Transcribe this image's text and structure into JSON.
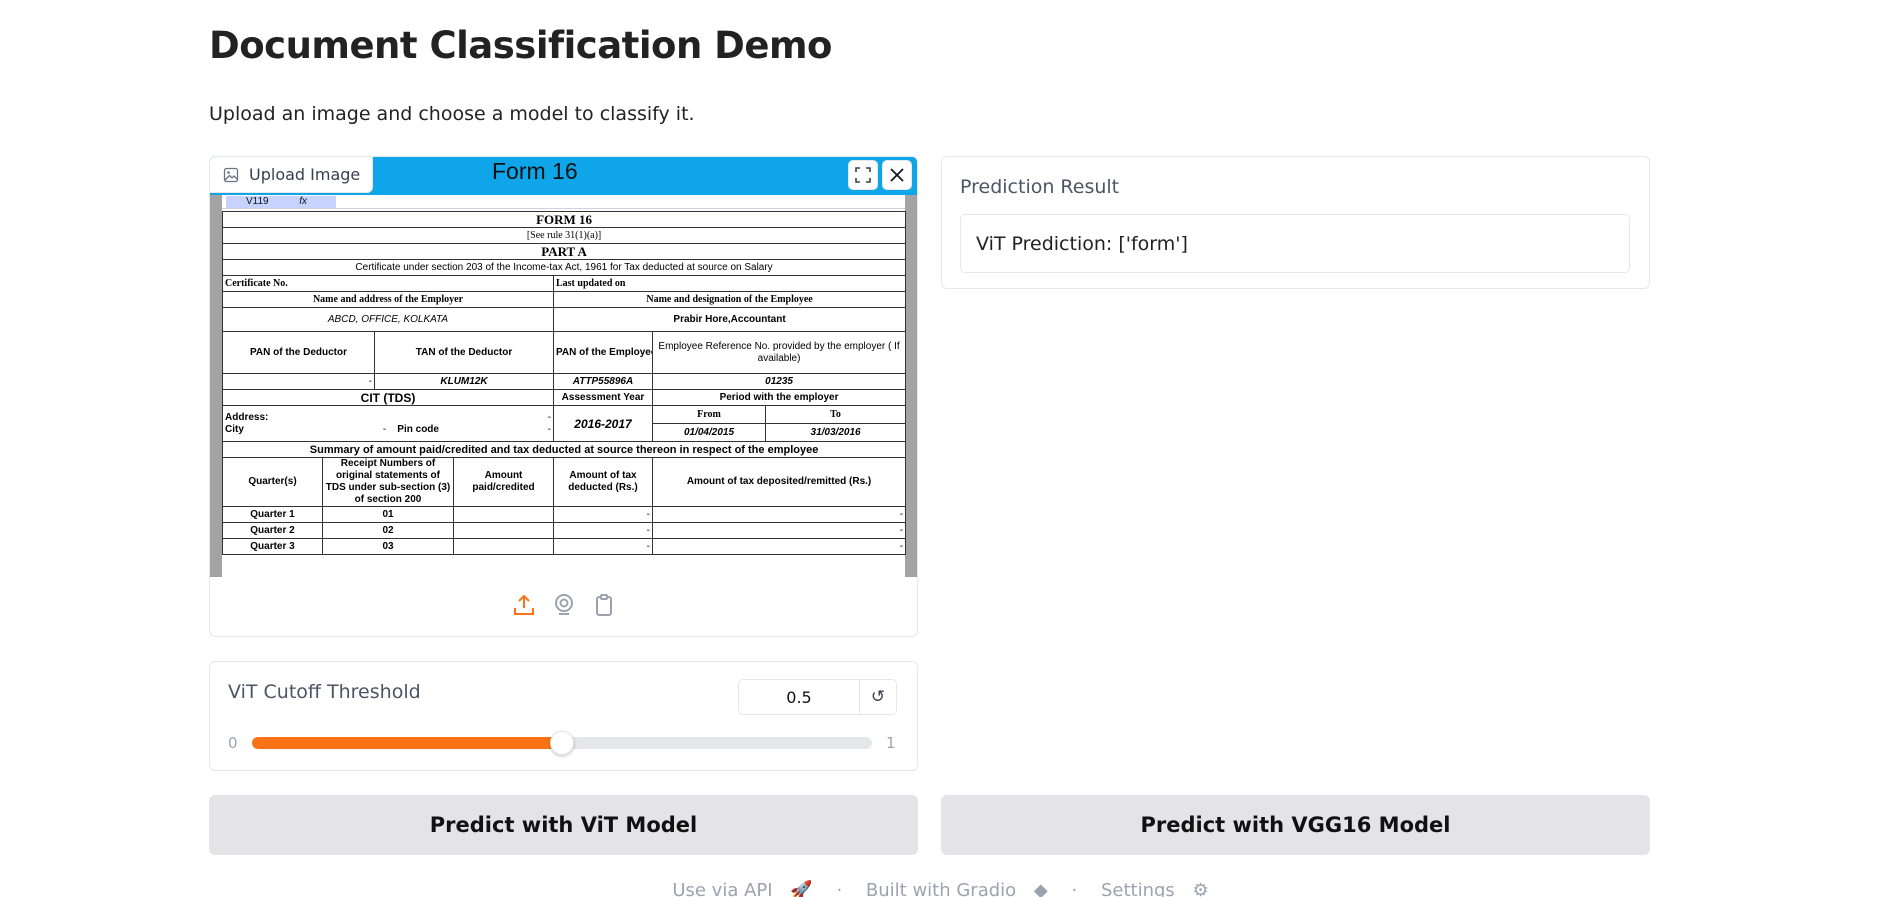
{
  "page": {
    "title": "Document Classification Demo",
    "description": "Upload an image and choose a model to classify it."
  },
  "image_input": {
    "label": "Upload Image",
    "icons": {
      "fullscreen": "fullscreen-icon",
      "clear": "close-icon",
      "upload": "upload-icon",
      "webcam": "webcam-icon",
      "clipboard": "clipboard-icon"
    },
    "document": {
      "banner": "Form 16",
      "cell_ref": "V119",
      "fx": "fx",
      "form_title": "FORM 16",
      "rule": "[See rule 31(1)(a)]",
      "part": "PART A",
      "certificate_line": "Certificate under section 203 of the Income-tax Act, 1961 for Tax deducted at source on Salary",
      "certificate_no": "Certificate No.",
      "last_updated": "Last updated on",
      "employer_name_hdr": "Name and address of the Employer",
      "employee_name_hdr": "Name and designation of the Employee",
      "employer_name": "ABCD, OFFICE, KOLKATA",
      "employee_name": "Prabir Hore,Accountant",
      "pan_deductor_hdr": "PAN of the Deductor",
      "tan_deductor_hdr": "TAN of the Deductor",
      "pan_employee_hdr": "PAN of the Employee",
      "emp_ref_hdr": "Employee Reference No. provided by the employer ( If available)",
      "pan_deductor": "-",
      "tan_deductor": "KLUM12K",
      "pan_employee": "ATTP55896A",
      "emp_ref": "01235",
      "cit_hdr": "CIT (TDS)",
      "assessment_hdr": "Assessment Year",
      "period_hdr": "Period with the employer",
      "address": "Address:",
      "city": "City",
      "pincode": "Pin code",
      "dash": "-",
      "assessment_year": "2016-2017",
      "from_hdr": "From",
      "to_hdr": "To",
      "from": "01/04/2015",
      "to": "31/03/2016",
      "summary": "Summary of amount paid/credited and tax deducted at source thereon in respect of the employee",
      "col_quarters": "Quarter(s)",
      "col_receipt": "Receipt Numbers of original statements of TDS under sub-section (3) of section 200",
      "col_amount": "Amount paid/credited",
      "col_tax_deducted": "Amount of tax deducted (Rs.)",
      "col_tax_deposited": "Amount of tax deposited/remitted (Rs.)",
      "rows": [
        {
          "quarter": "Quarter 1",
          "receipt": "01",
          "amount": "",
          "deducted": "-",
          "deposited": "-"
        },
        {
          "quarter": "Quarter 2",
          "receipt": "02",
          "amount": "",
          "deducted": "-",
          "deposited": "-"
        },
        {
          "quarter": "Quarter 3",
          "receipt": "03",
          "amount": "",
          "deducted": "-",
          "deposited": "-"
        }
      ]
    }
  },
  "slider": {
    "label": "ViT Cutoff Threshold",
    "value": "0.5",
    "value_fraction": 0.5,
    "min": "0",
    "max": "1",
    "reset_icon": "reset-icon",
    "reset_glyph": "↺"
  },
  "result": {
    "label": "Prediction Result",
    "text": "ViT Prediction: ['form']"
  },
  "buttons": {
    "vit": "Predict with ViT Model",
    "vgg": "Predict with VGG16 Model"
  },
  "footer": {
    "api": "Use via API",
    "built": "Built with Gradio",
    "settings": "Settings",
    "sep": "·"
  },
  "colors": {
    "accent": "#f97316",
    "banner": "#0ea5e9"
  }
}
